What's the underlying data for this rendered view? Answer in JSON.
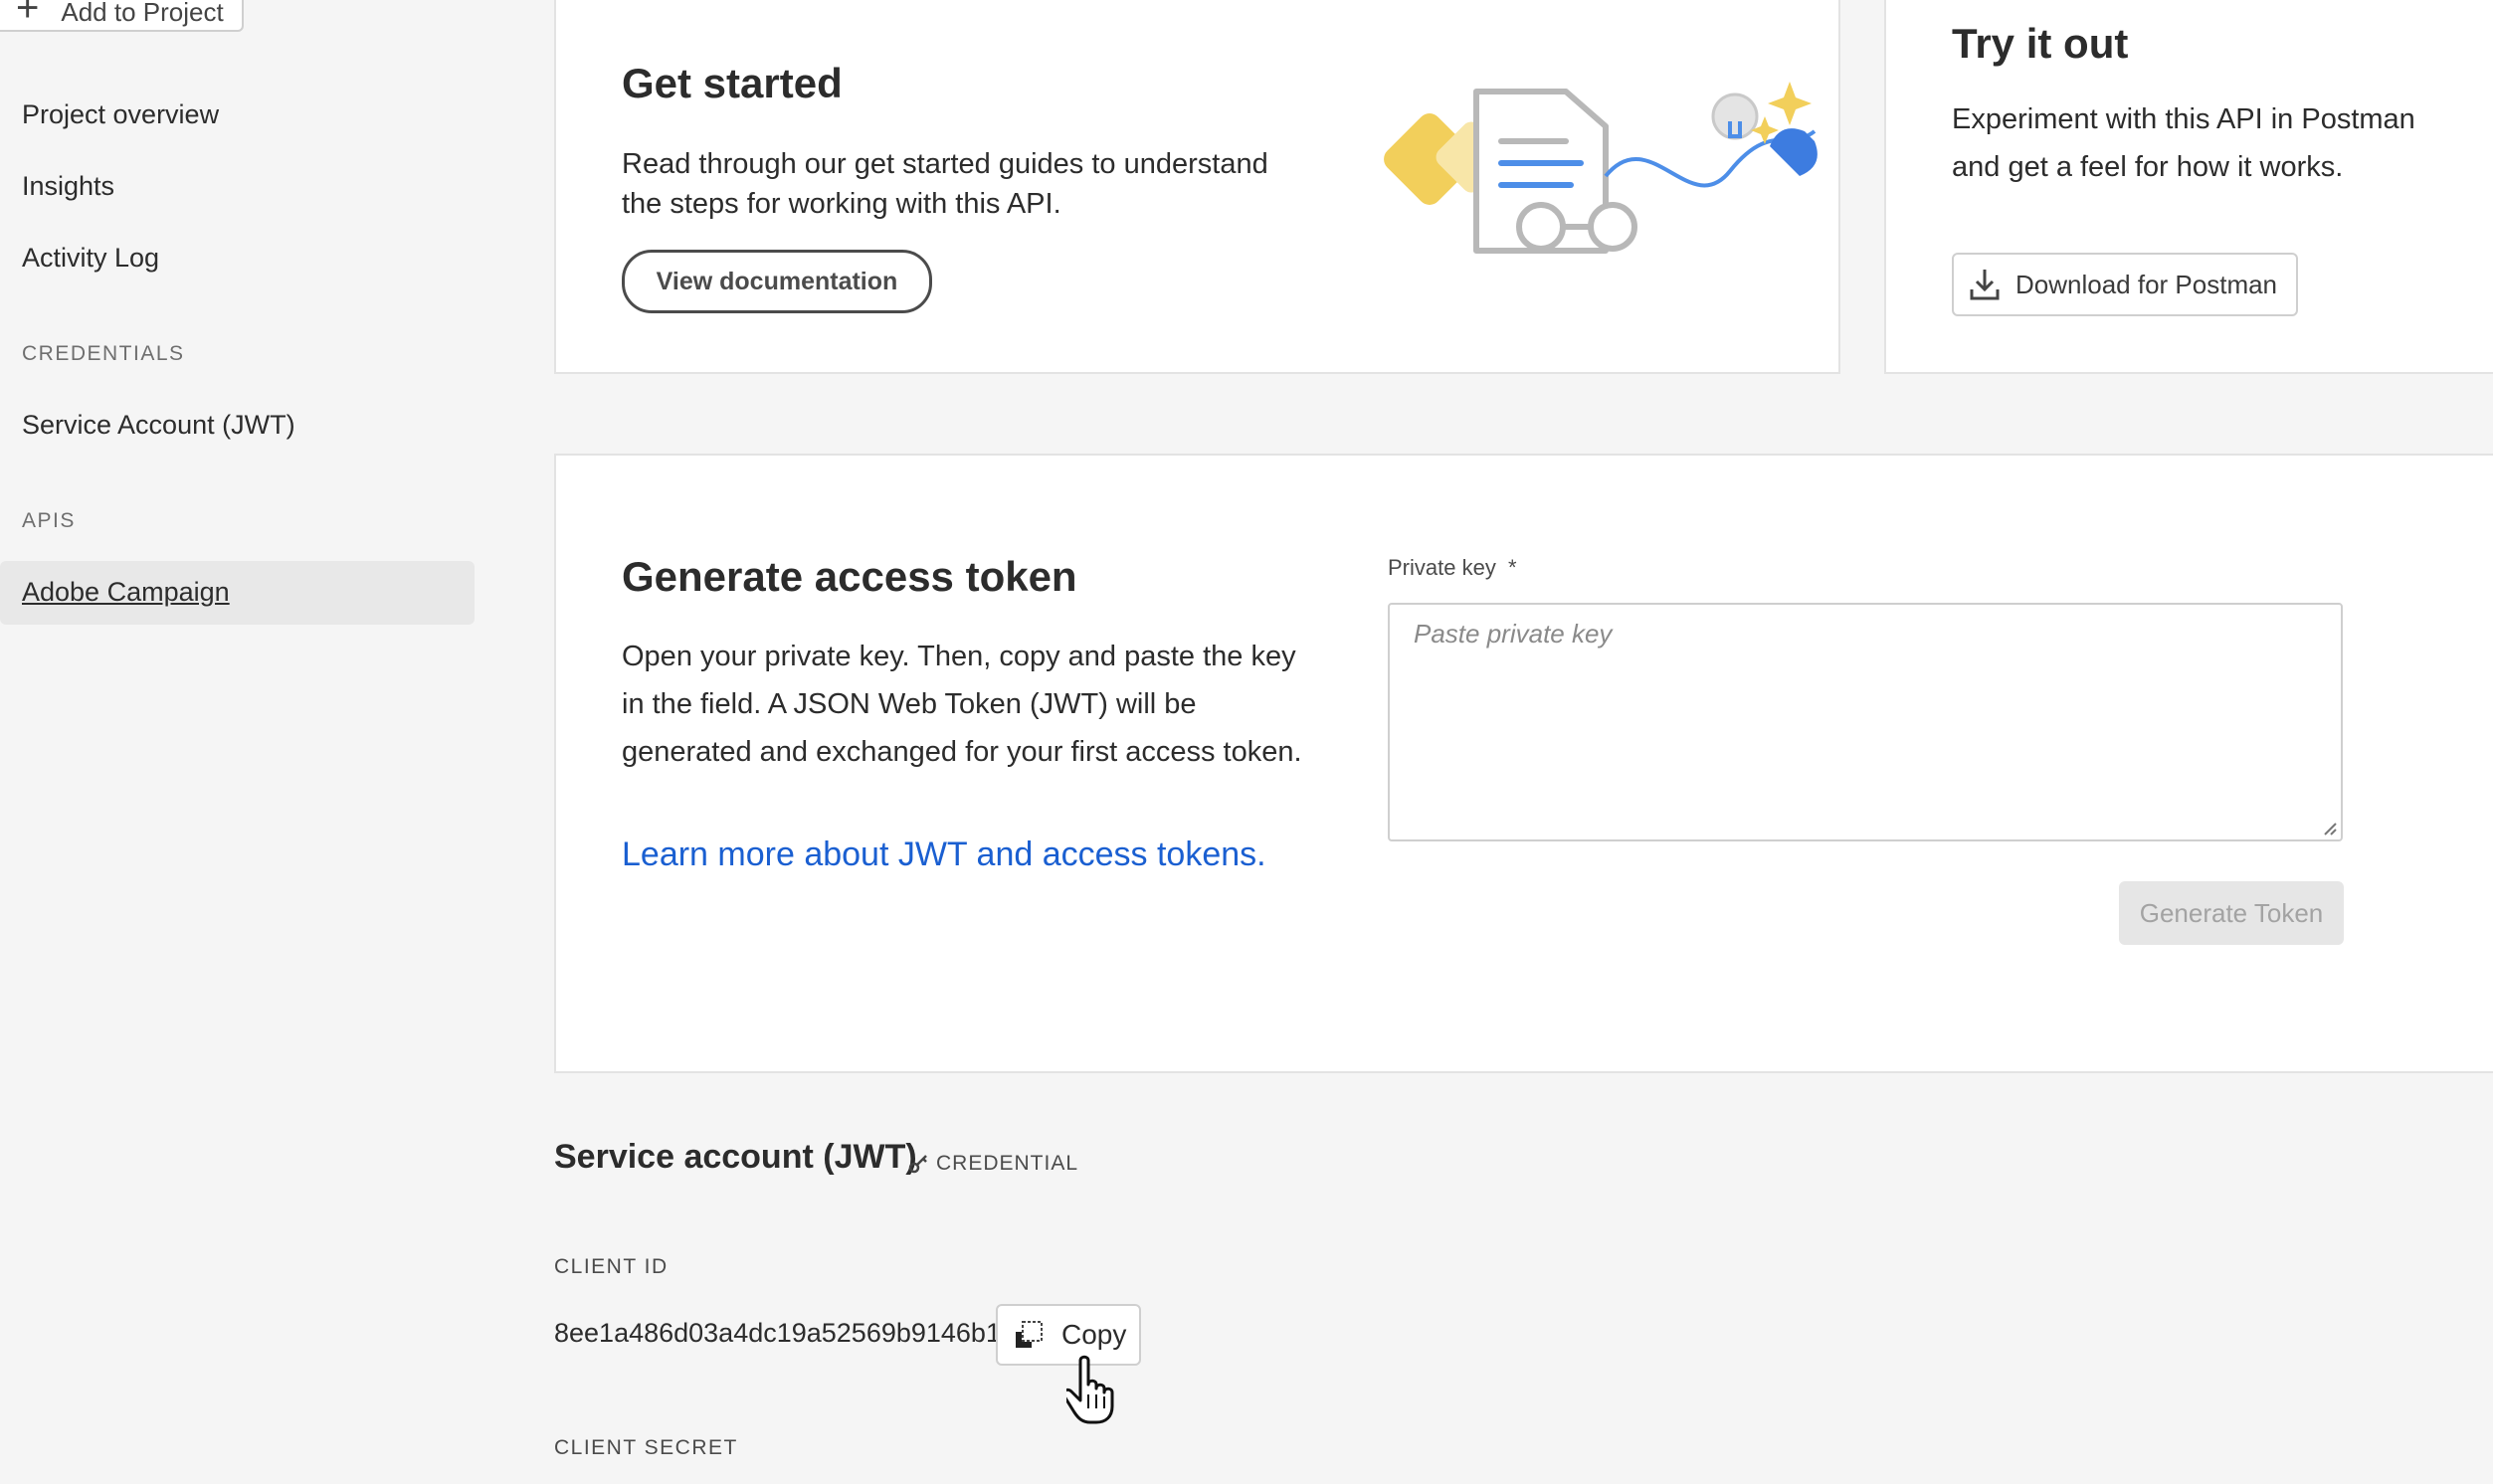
{
  "sidebar": {
    "add_to_project": "Add to Project",
    "items": [
      {
        "label": "Project overview"
      },
      {
        "label": "Insights"
      },
      {
        "label": "Activity Log"
      }
    ],
    "credentials_heading": "CREDENTIALS",
    "credentials_item": "Service Account (JWT)",
    "apis_heading": "APIS",
    "apis_item": "Adobe Campaign"
  },
  "get_started": {
    "title": "Get started",
    "description": "Read through our get started guides to understand the steps for working with this API.",
    "button": "View documentation"
  },
  "try_it_out": {
    "title": "Try it out",
    "description": "Experiment with this API in Postman and get a feel for how it works.",
    "button": "Download for Postman"
  },
  "generate_token": {
    "title": "Generate access token",
    "description": "Open your private key. Then, copy and paste the key in the field. A JSON Web Token (JWT) will be generated and exchanged for your first access token.",
    "link": "Learn more about JWT and access tokens.",
    "field_label": "Private key",
    "required_mark": "*",
    "placeholder": "Paste private key",
    "button": "Generate Token"
  },
  "service_account": {
    "title": "Service account (JWT)",
    "badge": "CREDENTIAL",
    "client_id_label": "CLIENT ID",
    "client_id_value": "8ee1a486d03a4dc19a52569b9146b1ad",
    "copy_label": "Copy",
    "client_secret_label": "CLIENT SECRET"
  },
  "colors": {
    "link": "#1a5fd1",
    "background": "#f5f5f5",
    "card": "#ffffff"
  }
}
